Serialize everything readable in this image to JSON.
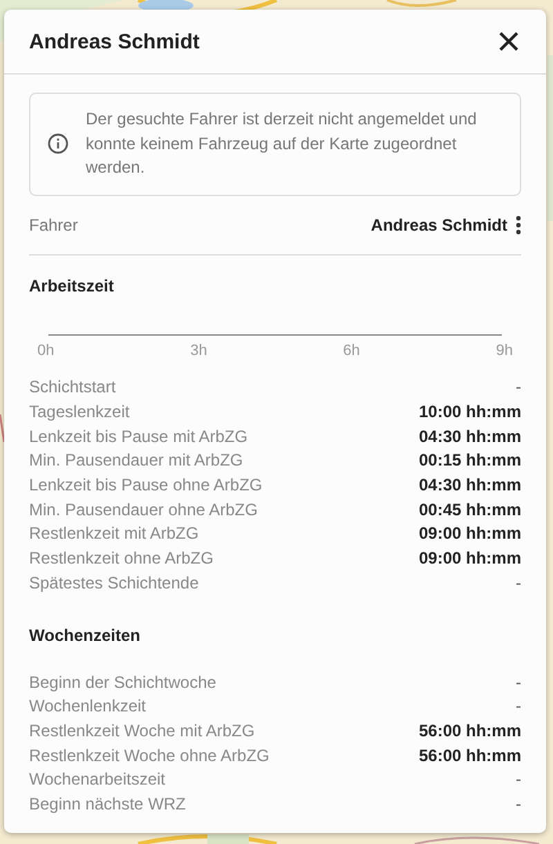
{
  "panel": {
    "title": "Andreas Schmidt",
    "info": "Der gesuchte Fahrer ist derzeit nicht angemeldet und konnte keinem Fahrzeug auf der Karte zugeordnet werden.",
    "driver": {
      "label": "Fahrer",
      "value": "Andreas Schmidt"
    }
  },
  "sections": [
    {
      "title": "Arbeitszeit",
      "timeline": {
        "ticks": [
          "0h",
          "3h",
          "6h",
          "9h"
        ]
      },
      "rows": [
        {
          "label": "Schichtstart",
          "value": "-"
        },
        {
          "label": "Tageslenkzeit",
          "value": "10:00 hh:mm"
        },
        {
          "label": "Lenkzeit bis Pause mit ArbZG",
          "value": "04:30 hh:mm"
        },
        {
          "label": "Min. Pausendauer mit ArbZG",
          "value": "00:15 hh:mm"
        },
        {
          "label": "Lenkzeit bis Pause ohne ArbZG",
          "value": "04:30 hh:mm"
        },
        {
          "label": "Min. Pausendauer ohne ArbZG",
          "value": "00:45 hh:mm"
        },
        {
          "label": "Restlenkzeit mit ArbZG",
          "value": "09:00 hh:mm"
        },
        {
          "label": "Restlenkzeit ohne ArbZG",
          "value": "09:00 hh:mm"
        },
        {
          "label": "Spätestes Schichtende",
          "value": "-"
        }
      ]
    },
    {
      "title": "Wochenzeiten",
      "rows": [
        {
          "label": "Beginn der Schichtwoche",
          "value": "-"
        },
        {
          "label": "Wochenlenkzeit",
          "value": "-"
        },
        {
          "label": "Restlenkzeit Woche mit ArbZG",
          "value": "56:00 hh:mm"
        },
        {
          "label": "Restlenkzeit Woche ohne ArbZG",
          "value": "56:00 hh:mm"
        },
        {
          "label": "Wochenarbeitszeit",
          "value": "-"
        },
        {
          "label": "Beginn nächste WRZ",
          "value": "-"
        }
      ]
    }
  ]
}
